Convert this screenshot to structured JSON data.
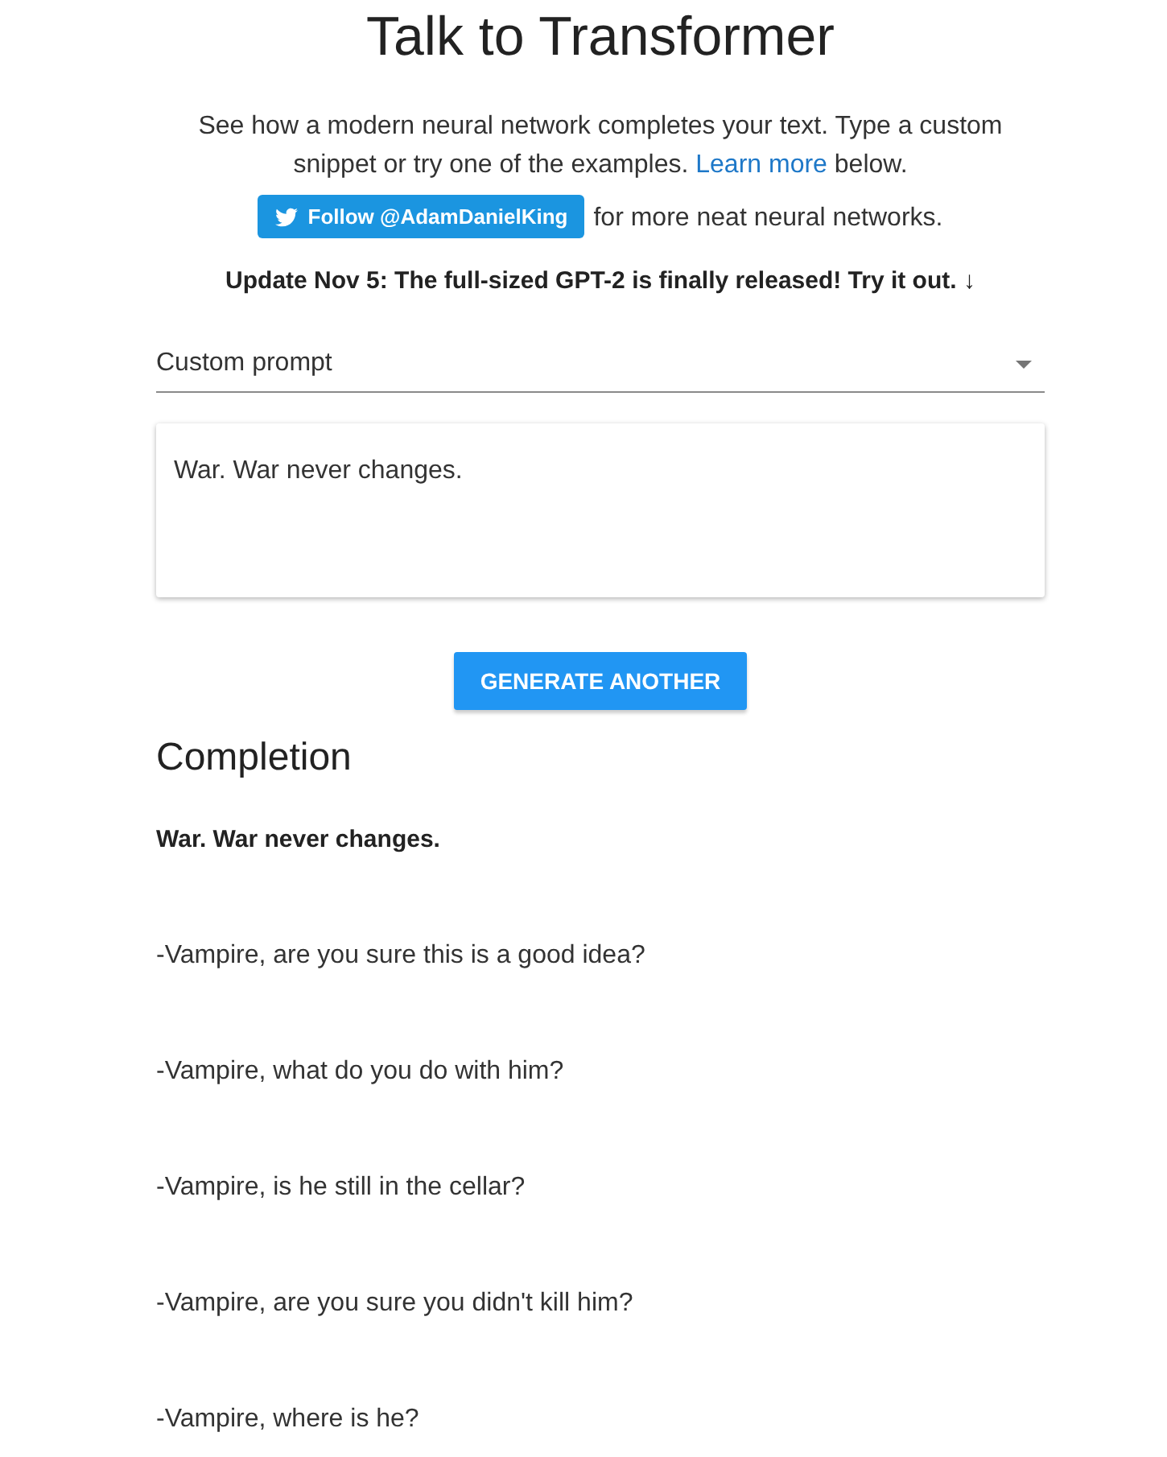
{
  "title": "Talk to Transformer",
  "intro": {
    "text": "See how a modern neural network completes your text. Type a custom snippet or try one of the examples.",
    "link": "Learn more",
    "after": "below."
  },
  "follow": {
    "button": "Follow @AdamDanielKing",
    "after": "for more neat neural networks."
  },
  "update": "Update Nov 5: The full-sized GPT-2 is finally released! Try it out. ↓",
  "prompt_select": {
    "value": "Custom prompt"
  },
  "prompt_field": {
    "value": "War. War never changes."
  },
  "generate_button": "GENERATE ANOTHER",
  "completion": {
    "heading": "Completion",
    "prompt": "War. War never changes.",
    "lines": [
      "-Vampire, are you sure this is a good idea?",
      "-Vampire, what do you do with him?",
      "-Vampire, is he still in the cellar?",
      "-Vampire, are you sure you didn't kill him?",
      "-Vampire, where is he?"
    ]
  }
}
